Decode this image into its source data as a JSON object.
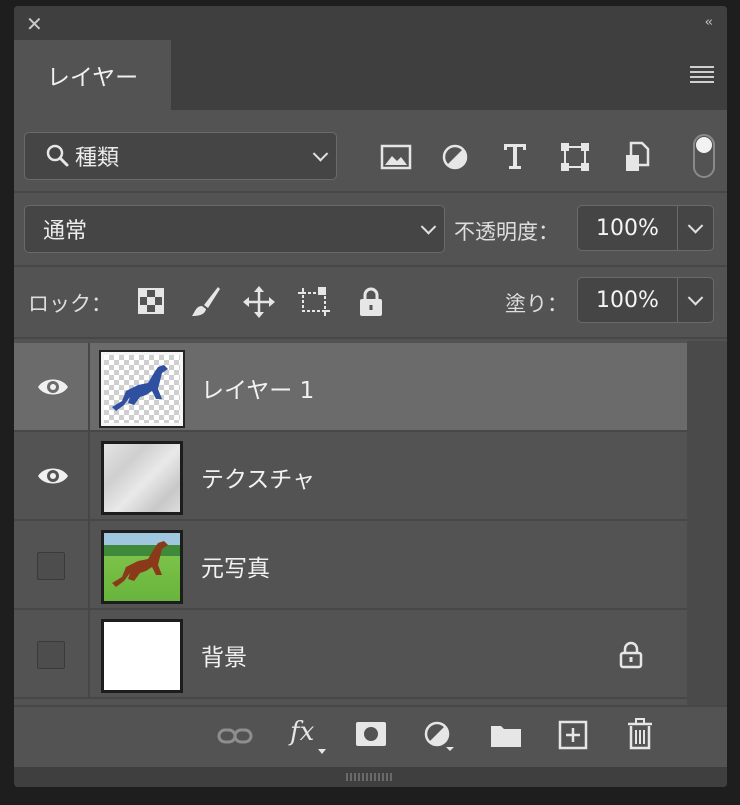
{
  "window": {
    "close_icon": "close-icon",
    "collapse_icon": "collapse-icon",
    "collapse_glyph": "‹‹"
  },
  "tab": {
    "label": "レイヤー"
  },
  "filter": {
    "kind_label": "種類",
    "icons": [
      "image-filter-icon",
      "adjustment-filter-icon",
      "type-filter-icon",
      "shape-filter-icon",
      "smart-object-filter-icon"
    ]
  },
  "blend": {
    "mode": "通常",
    "opacity_label": "不透明度：",
    "opacity_value": "100%"
  },
  "lock": {
    "label": "ロック：",
    "icons": [
      "lock-transparent-pixels-icon",
      "lock-image-pixels-icon",
      "lock-position-icon",
      "lock-artboard-icon",
      "lock-all-icon"
    ],
    "fill_label": "塗り：",
    "fill_value": "100%"
  },
  "layers": [
    {
      "name": "レイヤー 1",
      "visible": true,
      "selected": true,
      "locked": false,
      "thumb": "horse-silhouette"
    },
    {
      "name": "テクスチャ",
      "visible": true,
      "selected": false,
      "locked": false,
      "thumb": "texture"
    },
    {
      "name": "元写真",
      "visible": false,
      "selected": false,
      "locked": false,
      "thumb": "horse-photo"
    },
    {
      "name": "背景",
      "visible": false,
      "selected": false,
      "locked": true,
      "thumb": "white"
    }
  ],
  "footer": {
    "fx_label": "fx",
    "icons": [
      "link-layers-icon",
      "layer-style-icon",
      "add-mask-icon",
      "adjustment-layer-icon",
      "new-group-icon",
      "new-layer-icon",
      "delete-icon"
    ]
  },
  "colors": {
    "panel": "#535353",
    "titlebar": "#3f3f3f",
    "selected_row": "#6b6b6b",
    "silhouette": "#2f4fa0"
  }
}
